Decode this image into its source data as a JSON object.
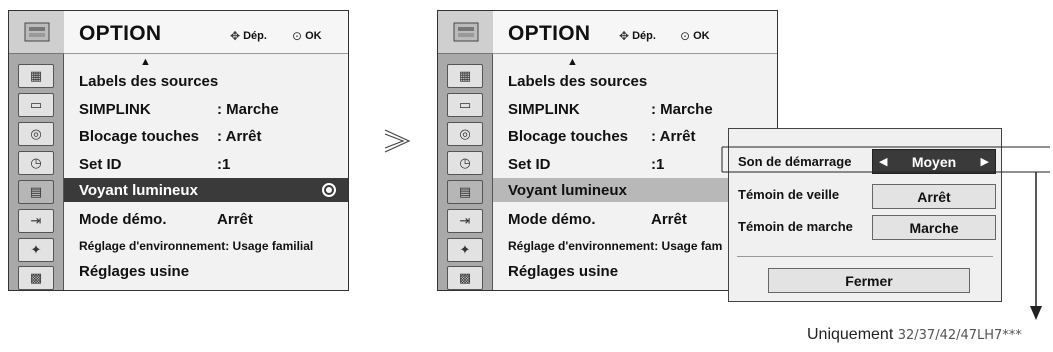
{
  "left_menu": {
    "title": "OPTION",
    "nav_hint": "Dép.",
    "ok_hint": "OK",
    "items": [
      {
        "label": "Labels des sources",
        "value": ""
      },
      {
        "label": "SIMPLINK",
        "value": ": Marche"
      },
      {
        "label": "Blocage touches",
        "value": ": Arrêt"
      },
      {
        "label": "Set ID",
        "value": ":1"
      },
      {
        "label": "Voyant lumineux",
        "value": ""
      },
      {
        "label": "Mode démo.",
        "value": "Arrêt"
      },
      {
        "label": "Réglage d'environnement: Usage familial",
        "value": ""
      },
      {
        "label": "Réglages usine",
        "value": ""
      }
    ],
    "selected_item": "Voyant lumineux"
  },
  "right_menu": {
    "title": "OPTION",
    "nav_hint": "Dép.",
    "ok_hint": "OK",
    "items": [
      {
        "label": "Labels des sources",
        "value": ""
      },
      {
        "label": "SIMPLINK",
        "value": ": Marche"
      },
      {
        "label": "Blocage touches",
        "value": ": Arrêt"
      },
      {
        "label": "Set ID",
        "value": ":1"
      },
      {
        "label": "Voyant lumineux",
        "value": ""
      },
      {
        "label": "Mode démo.",
        "value": "Arrêt"
      },
      {
        "label": "Réglage d'environnement: Usage fam",
        "value": ""
      },
      {
        "label": "Réglages usine",
        "value": ""
      }
    ]
  },
  "popup": {
    "startup_sound_label": "Son de démarrage",
    "startup_sound_value": "Moyen",
    "standby_led_label": "Témoin de veille",
    "standby_led_value": "Arrêt",
    "power_led_label": "Témoin de marche",
    "power_led_value": "Marche",
    "close_label": "Fermer"
  },
  "footnote": {
    "prefix": "Uniquement",
    "models": "32/37/42/47LH7***"
  },
  "icons": [
    "settings-icon",
    "picture-icon",
    "screen-icon",
    "audio-icon",
    "clock-icon",
    "lock-icon",
    "input-icon",
    "usb-icon",
    "photo-icon"
  ]
}
